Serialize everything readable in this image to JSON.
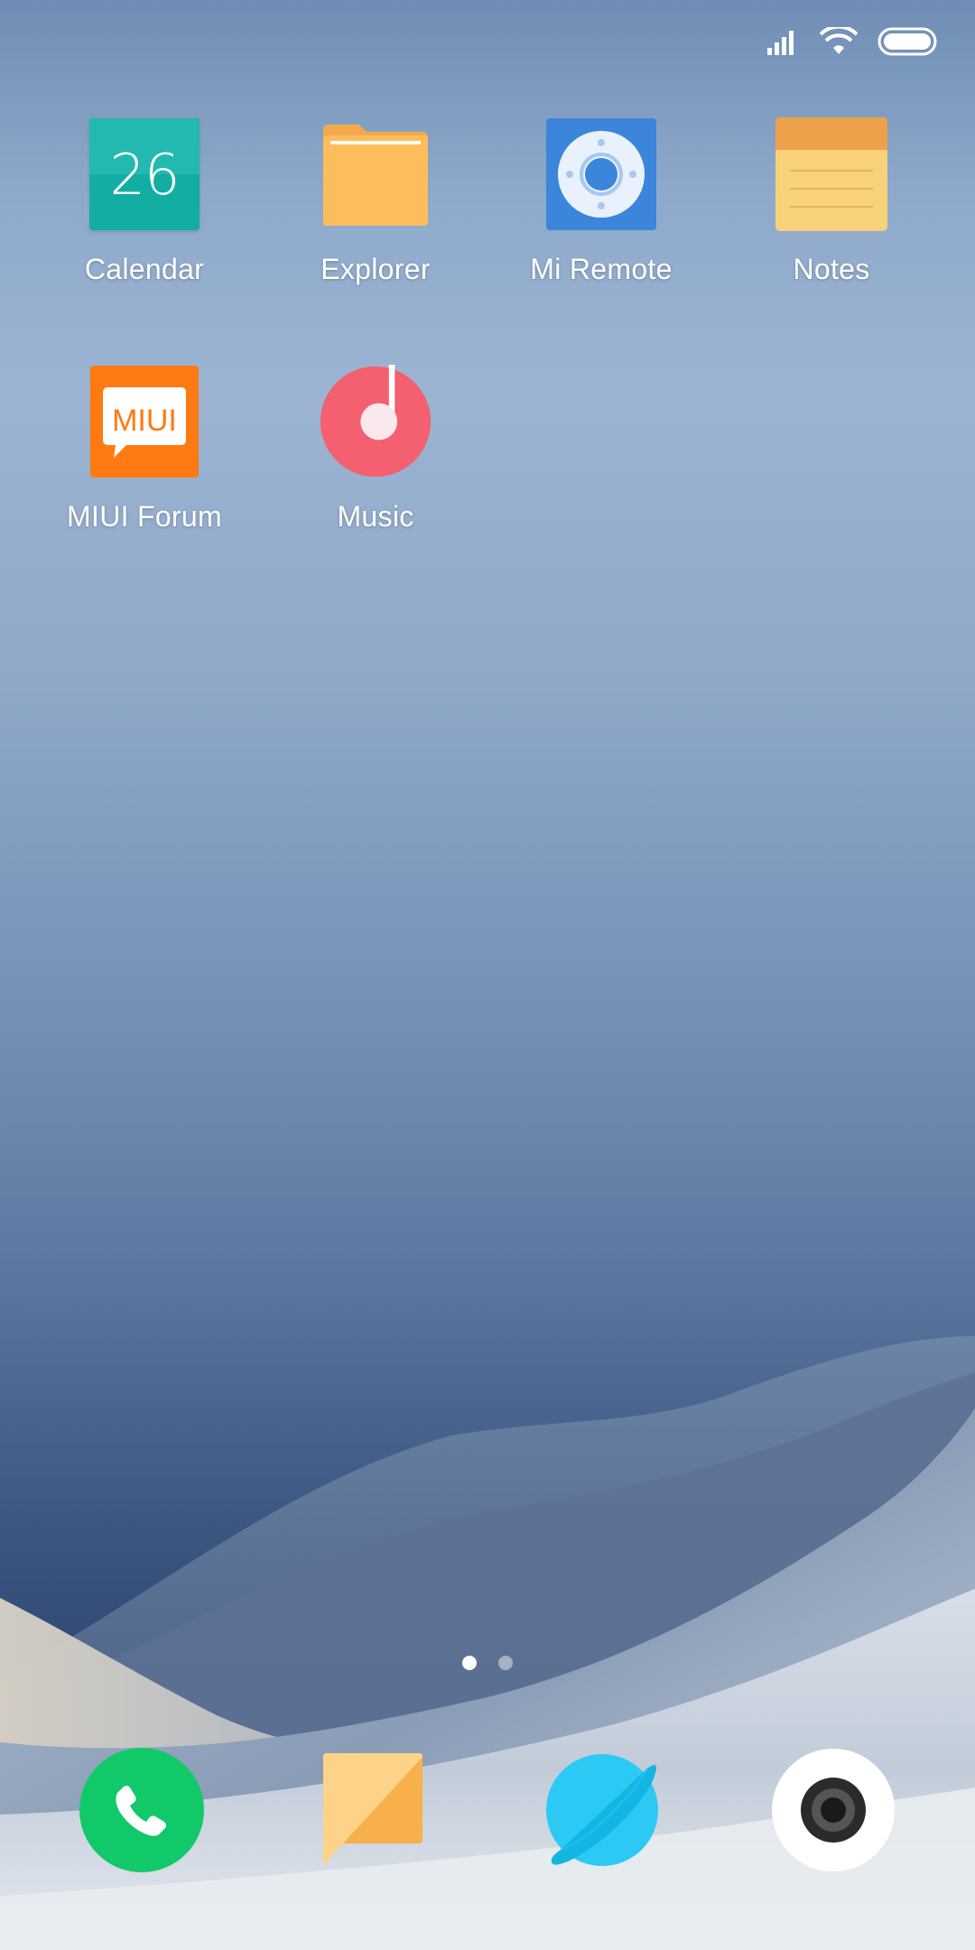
{
  "apps": [
    {
      "id": "calendar",
      "label": "Calendar",
      "date_number": "26"
    },
    {
      "id": "explorer",
      "label": "Explorer"
    },
    {
      "id": "mi-remote",
      "label": "Mi Remote"
    },
    {
      "id": "notes",
      "label": "Notes"
    },
    {
      "id": "miui-forum",
      "label": "MIUI Forum",
      "badge_text": "MIUI"
    },
    {
      "id": "music",
      "label": "Music"
    }
  ],
  "dock": [
    {
      "id": "phone",
      "icon": "phone-icon"
    },
    {
      "id": "messaging",
      "icon": "message-icon"
    },
    {
      "id": "browser",
      "icon": "browser-icon"
    },
    {
      "id": "camera",
      "icon": "camera-icon"
    }
  ],
  "pager": {
    "page_count": 2,
    "current_page": 1
  },
  "colors": {
    "calendar": "#1fb6ad",
    "explorer": "#fdbd5c",
    "mi_remote": "#3b86db",
    "notes": "#f7d27a",
    "miui_forum": "#ff7a12",
    "music": "#f4606f",
    "phone": "#12c96a",
    "messaging": "#fcc05f",
    "browser": "#2cc9f4",
    "camera": "#ffffff"
  }
}
